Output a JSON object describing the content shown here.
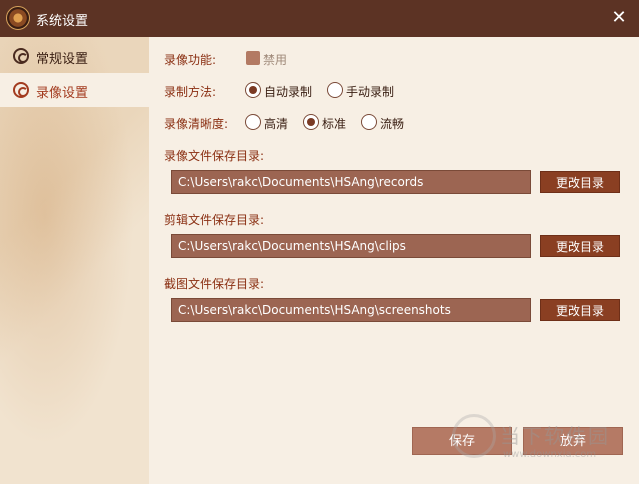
{
  "window": {
    "title": "系统设置",
    "close_glyph": "✕"
  },
  "sidebar": {
    "items": [
      {
        "label": "常规设置",
        "icon": "swirl-icon",
        "active": false
      },
      {
        "label": "录像设置",
        "icon": "swirl-icon",
        "active": true
      }
    ]
  },
  "recording": {
    "feature_label": "录像功能:",
    "feature_option": "禁用",
    "method_label": "录制方法:",
    "method_options": [
      "自动录制",
      "手动录制"
    ],
    "method_selected": "自动录制",
    "quality_label": "录像清晰度:",
    "quality_options": [
      "高清",
      "标准",
      "流畅"
    ],
    "quality_selected": "标准",
    "records_dir_label": "录像文件保存目录:",
    "records_dir": "C:\\Users\\rakc\\Documents\\HSAng\\records",
    "clips_dir_label": "剪辑文件保存目录:",
    "clips_dir": "C:\\Users\\rakc\\Documents\\HSAng\\clips",
    "screenshots_dir_label": "截图文件保存目录:",
    "screenshots_dir": "C:\\Users\\rakc\\Documents\\HSAng\\screenshots",
    "change_dir_button": "更改目录"
  },
  "footer": {
    "save_button": "保存",
    "discard_button": "放弃"
  },
  "watermark": {
    "brand": "当下软件园",
    "url": "www.downxia.com"
  },
  "colors": {
    "titlebar": "#5c3324",
    "accent": "#8a3f22",
    "label": "#8a2f12",
    "field": "#9c6552"
  }
}
